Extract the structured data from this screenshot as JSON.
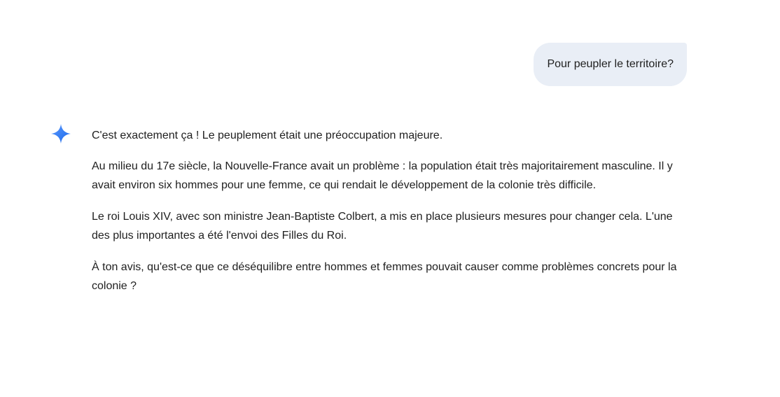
{
  "conversation": {
    "user_message": "Pour peupler le territoire?",
    "model_response": {
      "paragraphs": [
        "C'est exactement ça ! Le peuplement était une préoccupation majeure.",
        "Au milieu du 17e siècle, la Nouvelle-France avait un problème : la population était très majoritairement masculine. Il y avait environ six hommes pour une femme, ce qui rendait le développement de la colonie très difficile.",
        "Le roi Louis XIV, avec son ministre Jean-Baptiste Colbert, a mis en place plusieurs mesures pour changer cela. L'une des plus importantes a été l'envoi des Filles du Roi.",
        "À ton avis, qu'est-ce que ce déséquilibre entre hommes et femmes pouvait causer comme problèmes concrets pour la colonie ?"
      ]
    }
  },
  "icons": {
    "model_avatar": "sparkle-icon"
  },
  "colors": {
    "user_bubble_bg": "#e9eef6",
    "sparkle_start": "#4c8df6",
    "sparkle_end": "#1a66e8",
    "text": "#1f1f1f"
  }
}
